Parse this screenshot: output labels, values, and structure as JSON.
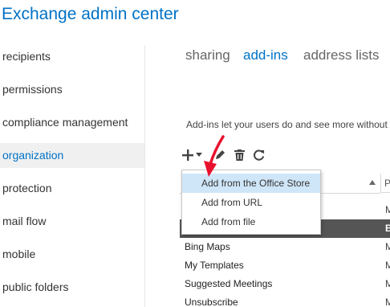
{
  "app": {
    "title": "Exchange admin center"
  },
  "sidebar": {
    "items": [
      {
        "label": "recipients",
        "selected": false
      },
      {
        "label": "permissions",
        "selected": false
      },
      {
        "label": "compliance management",
        "selected": false
      },
      {
        "label": "organization",
        "selected": true
      },
      {
        "label": "protection",
        "selected": false
      },
      {
        "label": "mail flow",
        "selected": false
      },
      {
        "label": "mobile",
        "selected": false
      },
      {
        "label": "public folders",
        "selected": false
      }
    ]
  },
  "tabs": [
    {
      "label": "sharing",
      "active": false
    },
    {
      "label": "add-ins",
      "active": true
    },
    {
      "label": "address lists",
      "active": false
    }
  ],
  "main": {
    "description": "Add-ins let your users do and see more without"
  },
  "toolbar": {
    "buttons": [
      {
        "icon": "plus-icon"
      },
      {
        "icon": "chevron-down-icon"
      },
      {
        "icon": "pencil-icon"
      },
      {
        "icon": "trash-icon"
      },
      {
        "icon": "refresh-icon"
      }
    ]
  },
  "add_menu": {
    "items": [
      {
        "label": "Add from the Office Store",
        "highlighted": true
      },
      {
        "label": "Add from URL",
        "highlighted": false
      },
      {
        "label": "Add from file",
        "highlighted": false
      }
    ]
  },
  "table": {
    "right_header": "P",
    "rows": [
      {
        "name": "",
        "col2": "M",
        "selected": false
      },
      {
        "name": "",
        "col2": "B",
        "selected": true
      },
      {
        "name": "Bing Maps",
        "col2": "M",
        "selected": false
      },
      {
        "name": "My Templates",
        "col2": "M",
        "selected": false
      },
      {
        "name": "Suggested Meetings",
        "col2": "M",
        "selected": false
      },
      {
        "name": "Unsubscribe",
        "col2": "M",
        "selected": false
      }
    ]
  },
  "colors": {
    "accent": "#0072c6",
    "menu_highlight": "#cfe6f8",
    "selected_row": "#555555",
    "pointer": "#e8112d"
  }
}
